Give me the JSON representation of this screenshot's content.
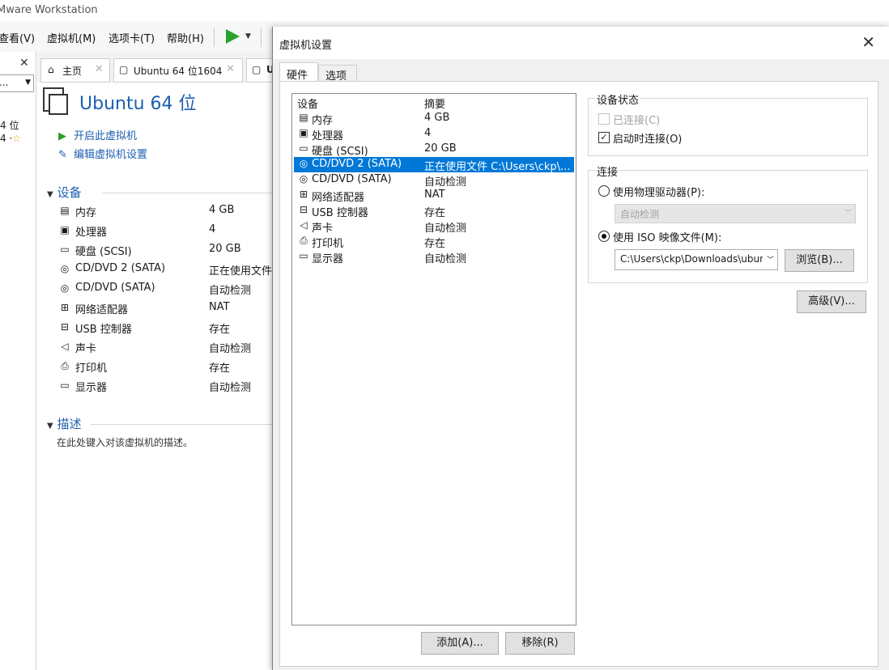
{
  "app": {
    "title": "Mware Workstation"
  },
  "menu": [
    {
      "label": "查看(V)"
    },
    {
      "label": "虚拟机(M)"
    },
    {
      "label": "选项卡(T)"
    },
    {
      "label": "帮助(H)"
    }
  ],
  "library": {
    "search_value": "...",
    "items": [
      "4 位",
      "4 ·"
    ]
  },
  "tabs": [
    {
      "label": "主页"
    },
    {
      "label": "Ubuntu 64 位1604"
    },
    {
      "label": "U"
    }
  ],
  "summary": {
    "vm_name": "Ubuntu 64 位",
    "actions": [
      {
        "label": "开启此虚拟机",
        "icon": "play-icon"
      },
      {
        "label": "编辑虚拟机设置",
        "icon": "edit-settings-icon"
      }
    ],
    "devices_header": "设备",
    "devices": [
      {
        "icon": "memory-icon",
        "name": "内存",
        "value": "4 GB"
      },
      {
        "icon": "processor-icon",
        "name": "处理器",
        "value": "4"
      },
      {
        "icon": "disk-icon",
        "name": "硬盘 (SCSI)",
        "value": "20 GB"
      },
      {
        "icon": "cd-icon",
        "name": "CD/DVD 2 (SATA)",
        "value": "正在使用文件"
      },
      {
        "icon": "cd-icon",
        "name": "CD/DVD (SATA)",
        "value": "自动检测"
      },
      {
        "icon": "network-icon",
        "name": "网络适配器",
        "value": "NAT"
      },
      {
        "icon": "usb-icon",
        "name": "USB 控制器",
        "value": "存在"
      },
      {
        "icon": "sound-icon",
        "name": "声卡",
        "value": "自动检测"
      },
      {
        "icon": "printer-icon",
        "name": "打印机",
        "value": "存在"
      },
      {
        "icon": "display-icon",
        "name": "显示器",
        "value": "自动检测"
      }
    ],
    "description_header": "描述",
    "description_hint": "在此处键入对该虚拟机的描述。"
  },
  "dialog": {
    "title": "虚拟机设置",
    "tabs": [
      {
        "label": "硬件"
      },
      {
        "label": "选项"
      }
    ],
    "list_headers": {
      "device": "设备",
      "summary": "摘要"
    },
    "devices": [
      {
        "icon": "memory-icon",
        "name": "内存",
        "value": "4 GB"
      },
      {
        "icon": "processor-icon",
        "name": "处理器",
        "value": "4"
      },
      {
        "icon": "disk-icon",
        "name": "硬盘 (SCSI)",
        "value": "20 GB"
      },
      {
        "icon": "cd-icon",
        "name": "CD/DVD 2 (SATA)",
        "value": "正在使用文件 C:\\Users\\ckp\\..."
      },
      {
        "icon": "cd-icon",
        "name": "CD/DVD (SATA)",
        "value": "自动检测"
      },
      {
        "icon": "network-icon",
        "name": "网络适配器",
        "value": "NAT"
      },
      {
        "icon": "usb-icon",
        "name": "USB 控制器",
        "value": "存在"
      },
      {
        "icon": "sound-icon",
        "name": "声卡",
        "value": "自动检测"
      },
      {
        "icon": "printer-icon",
        "name": "打印机",
        "value": "存在"
      },
      {
        "icon": "display-icon",
        "name": "显示器",
        "value": "自动检测"
      }
    ],
    "selected_device": "CD/DVD 2 (SATA)",
    "add_button": "添加(A)...",
    "remove_button": "移除(R)",
    "device_status": {
      "title": "设备状态",
      "connected_label": "已连接(C)",
      "connected": false,
      "connect_on_power_label": "启动时连接(O)",
      "connect_on_power": true
    },
    "connection": {
      "title": "连接",
      "physical_label": "使用物理驱动器(P):",
      "physical_value": "自动检测",
      "iso_label": "使用 ISO 映像文件(M):",
      "iso_path": "C:\\Users\\ckp\\Downloads\\ubun",
      "browse_button": "浏览(B)...",
      "selected": "iso"
    },
    "advanced_button": "高级(V)..."
  },
  "colors": {
    "selection": "#0078d7",
    "link": "#1c5fb0",
    "play_green": "#2aa12a"
  }
}
